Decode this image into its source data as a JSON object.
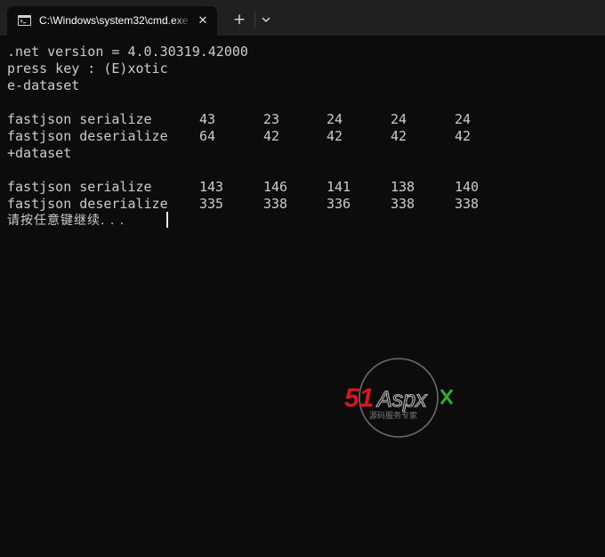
{
  "tab": {
    "title": "C:\\Windows\\system32\\cmd.exe",
    "close": "✕",
    "new_tab": "+"
  },
  "icons": {
    "tab_icon": "terminal-icon",
    "close": "close-icon",
    "new_tab": "plus-icon",
    "dropdown": "chevron-down-icon"
  },
  "colors": {
    "terminal_bg": "#0c0c0c",
    "titlebar_bg": "#202020",
    "text": "#cccccc",
    "watermark_red": "#d8171c",
    "watermark_green": "#2fae2f"
  },
  "terminal": {
    "header": [
      ".net version = 4.0.30319.42000",
      "press key : (E)xotic",
      "e-dataset"
    ],
    "block1": [
      {
        "label": "fastjson serialize",
        "values": [
          "43",
          "23",
          "24",
          "24",
          "24"
        ]
      },
      {
        "label": "fastjson deserialize",
        "values": [
          "64",
          "42",
          "42",
          "42",
          "42"
        ]
      }
    ],
    "section2": "+dataset",
    "block2": [
      {
        "label": "fastjson serialize",
        "values": [
          "143",
          "146",
          "141",
          "138",
          "140"
        ]
      },
      {
        "label": "fastjson deserialize",
        "values": [
          "335",
          "338",
          "336",
          "338",
          "338"
        ]
      }
    ],
    "prompt": "请按任意键继续. . ."
  },
  "watermark": {
    "brand_num": "51",
    "brand_text": "Aspx",
    "tagline": "源码服务专家"
  }
}
